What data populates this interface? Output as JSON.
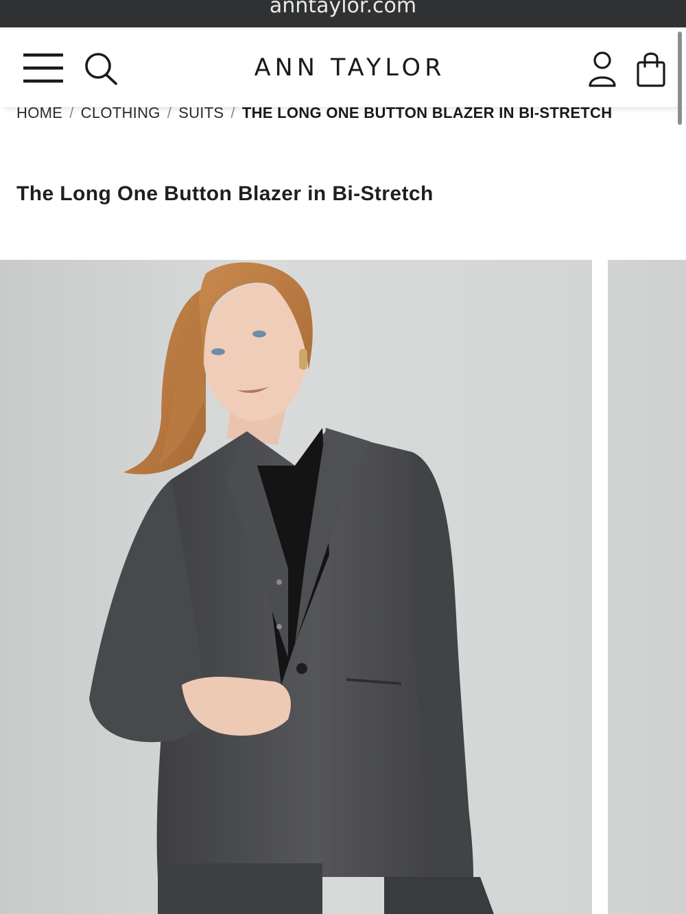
{
  "browser": {
    "domain": "anntaylor.com"
  },
  "header": {
    "logo": "ANN TAYLOR",
    "icons": {
      "menu": "hamburger-menu-icon",
      "search": "search-icon",
      "account": "account-icon",
      "bag": "shopping-bag-icon"
    }
  },
  "breadcrumb": {
    "items": [
      "HOME",
      "CLOTHING",
      "SUITS",
      "THE LONG ONE BUTTON BLAZER IN BI-STRETCH"
    ],
    "separator": "/"
  },
  "product": {
    "title": "The Long One Button Blazer in Bi-Stretch"
  },
  "colors": {
    "browser_bar": "#2f3133",
    "background": "#ffffff",
    "text": "#1a1a1a",
    "photo_bg": "#d6d8d8",
    "blazer": "#4a4b4d",
    "shirt": "#141414"
  }
}
